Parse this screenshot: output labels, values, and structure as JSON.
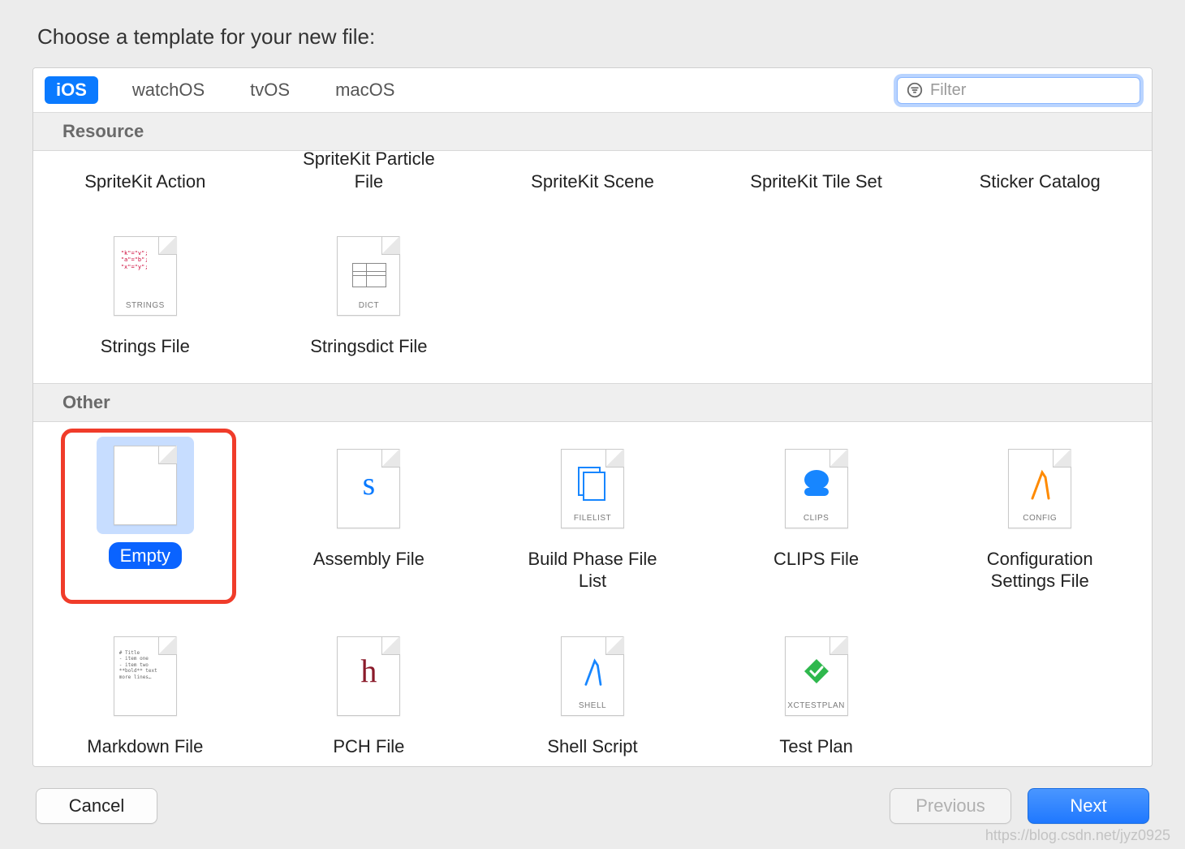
{
  "title": "Choose a template for your new file:",
  "tabs": [
    "iOS",
    "watchOS",
    "tvOS",
    "macOS"
  ],
  "tabs_active_index": 0,
  "filter": {
    "placeholder": "Filter",
    "value": ""
  },
  "sections": {
    "resource": {
      "header": "Resource",
      "row_cut": [
        {
          "label": "SpriteKit Action"
        },
        {
          "label": "SpriteKit Particle File"
        },
        {
          "label": "SpriteKit Scene"
        },
        {
          "label": "SpriteKit Tile Set"
        },
        {
          "label": "Sticker Catalog"
        }
      ],
      "row2": [
        {
          "label": "Strings File",
          "badge": "STRINGS",
          "kind": "strings"
        },
        {
          "label": "Stringsdict File",
          "badge": "DICT",
          "kind": "dict"
        }
      ]
    },
    "other": {
      "header": "Other",
      "row1": [
        {
          "label": "Empty",
          "badge": "",
          "kind": "empty",
          "selected": true,
          "highlighted": true
        },
        {
          "label": "Assembly File",
          "badge": "",
          "kind": "assembly"
        },
        {
          "label": "Build Phase File List",
          "badge": "FILELIST",
          "kind": "filelist"
        },
        {
          "label": "CLIPS File",
          "badge": "CLIPS",
          "kind": "clips"
        },
        {
          "label": "Configuration Settings File",
          "badge": "CONFIG",
          "kind": "config"
        }
      ],
      "row2": [
        {
          "label": "Markdown File",
          "badge": "",
          "kind": "markdown"
        },
        {
          "label": "PCH File",
          "badge": "",
          "kind": "pch"
        },
        {
          "label": "Shell Script",
          "badge": "SHELL",
          "kind": "shell"
        },
        {
          "label": "Test Plan",
          "badge": "XCTESTPLAN",
          "kind": "testplan"
        }
      ]
    }
  },
  "buttons": {
    "cancel": "Cancel",
    "previous": "Previous",
    "next": "Next"
  },
  "watermark": "https://blog.csdn.net/jyz0925"
}
